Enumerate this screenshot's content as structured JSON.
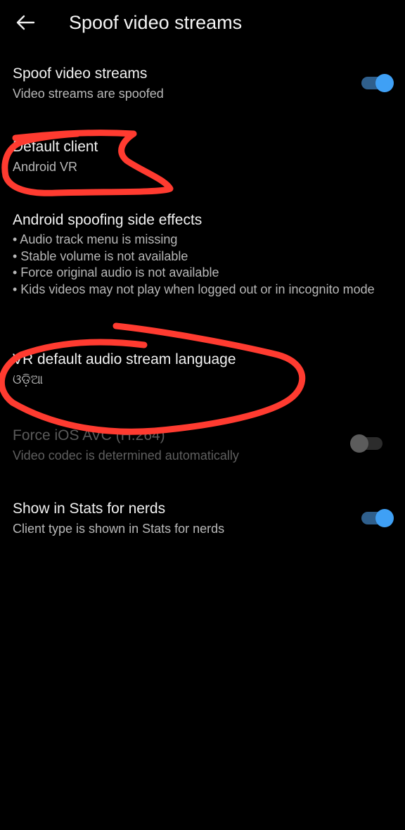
{
  "header": {
    "back_icon": "arrow-left-icon",
    "title": "Spoof video streams"
  },
  "spoof_video_streams": {
    "title": "Spoof video streams",
    "summary": "Video streams are spoofed",
    "toggle_state": "on"
  },
  "default_client": {
    "title": "Default client",
    "summary": "Android VR"
  },
  "side_effects": {
    "title": "Android spoofing side effects",
    "items": [
      "• Audio track menu is missing",
      "• Stable volume is not available",
      "• Force original audio is not available",
      "• Kids videos may not play when logged out or in incognito mode"
    ]
  },
  "vr_audio_language": {
    "title": "VR default audio stream language",
    "summary": "ଓଡ଼ିଆ"
  },
  "force_ios_avc": {
    "title": "Force iOS AVC (H.264)",
    "summary": "Video codec is determined automatically",
    "toggle_state": "off",
    "enabled": false
  },
  "stats_for_nerds": {
    "title": "Show in Stats for nerds",
    "summary": "Client type is shown in Stats for nerds",
    "toggle_state": "on"
  },
  "colors": {
    "background": "#000000",
    "accent": "#3fa0f5",
    "annotation": "#ff3b30"
  }
}
